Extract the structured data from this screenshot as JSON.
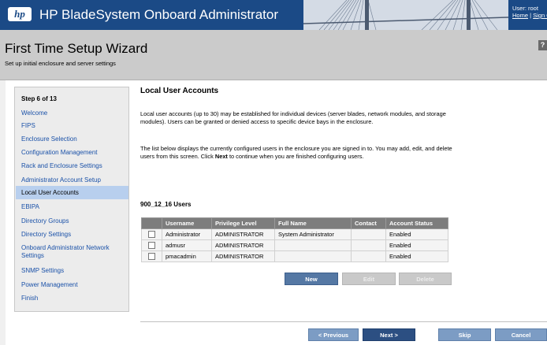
{
  "header": {
    "app_title": "HP BladeSystem Onboard Administrator",
    "logo_text": "hp",
    "user_label": "User: root",
    "home_link": "Home",
    "separator": "|",
    "signout_link": "Sign Out"
  },
  "wizard": {
    "title": "First Time Setup Wizard",
    "subtitle": "Set up initial enclosure and server settings",
    "help_label": "?"
  },
  "steps": {
    "header": "Step 6 of 13",
    "items": [
      {
        "label": "Welcome",
        "active": false
      },
      {
        "label": "FIPS",
        "active": false
      },
      {
        "label": "Enclosure Selection",
        "active": false
      },
      {
        "label": "Configuration Management",
        "active": false
      },
      {
        "label": "Rack and Enclosure Settings",
        "active": false
      },
      {
        "label": "Administrator Account Setup",
        "active": false
      },
      {
        "label": "Local User Accounts",
        "active": true
      },
      {
        "label": "EBIPA",
        "active": false
      },
      {
        "label": "Directory Groups",
        "active": false
      },
      {
        "label": "Directory Settings",
        "active": false
      },
      {
        "label": "Onboard Administrator Network Settings",
        "active": false
      },
      {
        "label": "SNMP Settings",
        "active": false
      },
      {
        "label": "Power Management",
        "active": false
      },
      {
        "label": "Finish",
        "active": false
      }
    ]
  },
  "main": {
    "section_title": "Local User Accounts",
    "para1": "Local user accounts (up to 30) may be established for individual devices (server blades, network modules, and storage modules). Users can be granted or denied access to specific device bays in the enclosure.",
    "para2_a": "The list below displays the currently configured users in the enclosure you are signed in to. You may add, edit, and delete users from this screen.  Click ",
    "para2_next": "Next",
    "para2_b": " to continue when you are finished configuring users.",
    "users_heading": "900_12_16 Users",
    "table": {
      "columns": [
        "Username",
        "Privilege Level",
        "Full Name",
        "Contact",
        "Account Status"
      ],
      "rows": [
        {
          "username": "Administrator",
          "privilege": "ADMINISTRATOR",
          "full_name": "System Administrator",
          "contact": "",
          "status": "Enabled"
        },
        {
          "username": "admusr",
          "privilege": "ADMINISTRATOR",
          "full_name": "",
          "contact": "",
          "status": "Enabled"
        },
        {
          "username": "pmacadmin",
          "privilege": "ADMINISTRATOR",
          "full_name": "",
          "contact": "",
          "status": "Enabled"
        }
      ]
    },
    "buttons": {
      "new": "New",
      "edit": "Edit",
      "delete": "Delete"
    }
  },
  "footer": {
    "previous": "< Previous",
    "next": "Next >",
    "skip": "Skip",
    "cancel": "Cancel"
  },
  "colors": {
    "header_blue": "#1b4a86",
    "link_blue": "#1a51a8",
    "active_step": "#b8cfee",
    "button_blue": "#5578a4"
  }
}
